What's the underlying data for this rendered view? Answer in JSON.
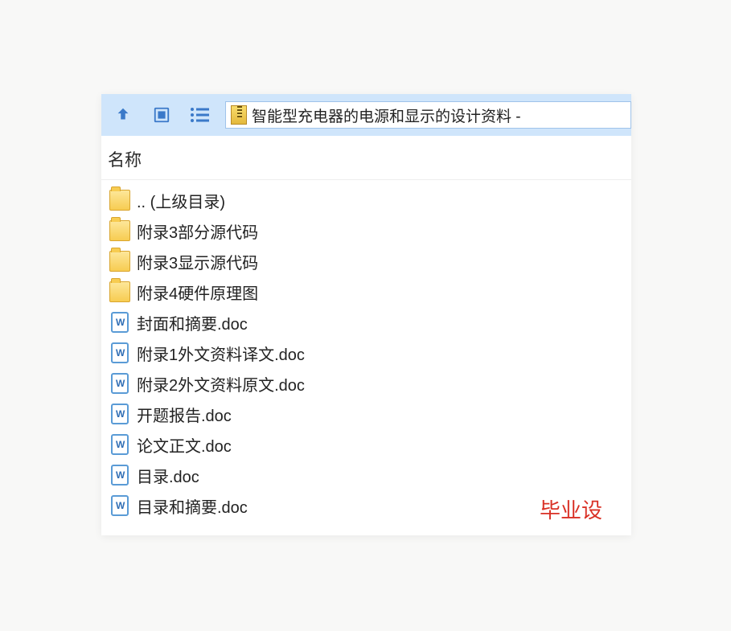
{
  "toolbar": {
    "path_title": "智能型充电器的电源和显示的设计资料 -"
  },
  "column_header": "名称",
  "items": [
    {
      "name": ".. (上级目录)",
      "type": "folder"
    },
    {
      "name": "附录3部分源代码",
      "type": "folder"
    },
    {
      "name": "附录3显示源代码",
      "type": "folder"
    },
    {
      "name": "附录4硬件原理图",
      "type": "folder"
    },
    {
      "name": "封面和摘要.doc",
      "type": "doc"
    },
    {
      "name": "附录1外文资料译文.doc",
      "type": "doc"
    },
    {
      "name": "附录2外文资料原文.doc",
      "type": "doc"
    },
    {
      "name": "开题报告.doc",
      "type": "doc"
    },
    {
      "name": "论文正文.doc",
      "type": "doc"
    },
    {
      "name": "目录.doc",
      "type": "doc"
    },
    {
      "name": "目录和摘要.doc",
      "type": "doc"
    }
  ],
  "watermark": "毕业设"
}
